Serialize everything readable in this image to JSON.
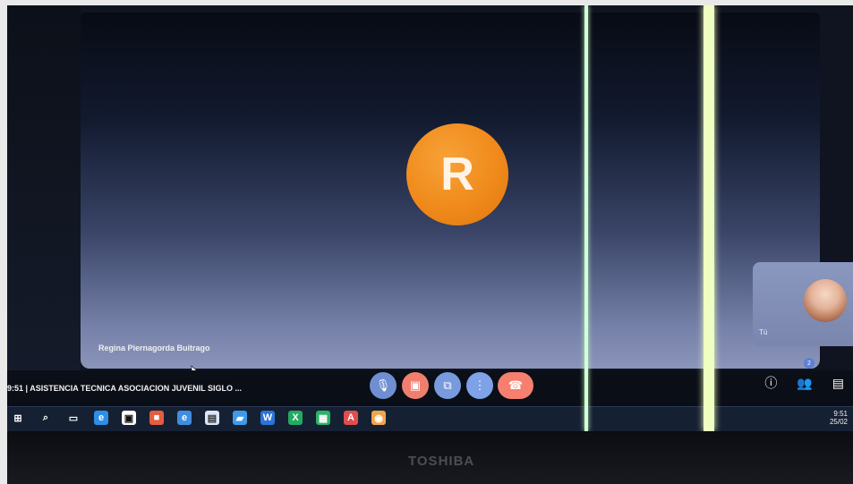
{
  "call": {
    "participant_initial": "R",
    "participant_name": "Regina Piernagorda Buitrago",
    "self_label": "Tú",
    "meeting_line": "9:51  |  ASISTENCIA TECNICA ASOCIACION JUVENIL SIGLO ..."
  },
  "controls": {
    "mic_icon": "microphone-icon",
    "camera_icon": "camera-icon",
    "present_icon": "present-screen-icon",
    "more_icon": "more-options-icon",
    "hangup_icon": "hangup-icon"
  },
  "right_panel": {
    "info_icon": "info-icon",
    "people_icon": "people-icon",
    "people_count": "2",
    "chat_icon": "chat-icon"
  },
  "taskbar": {
    "time": "9:51",
    "date": "25/02"
  },
  "device": {
    "brand": "TOSHIBA"
  }
}
